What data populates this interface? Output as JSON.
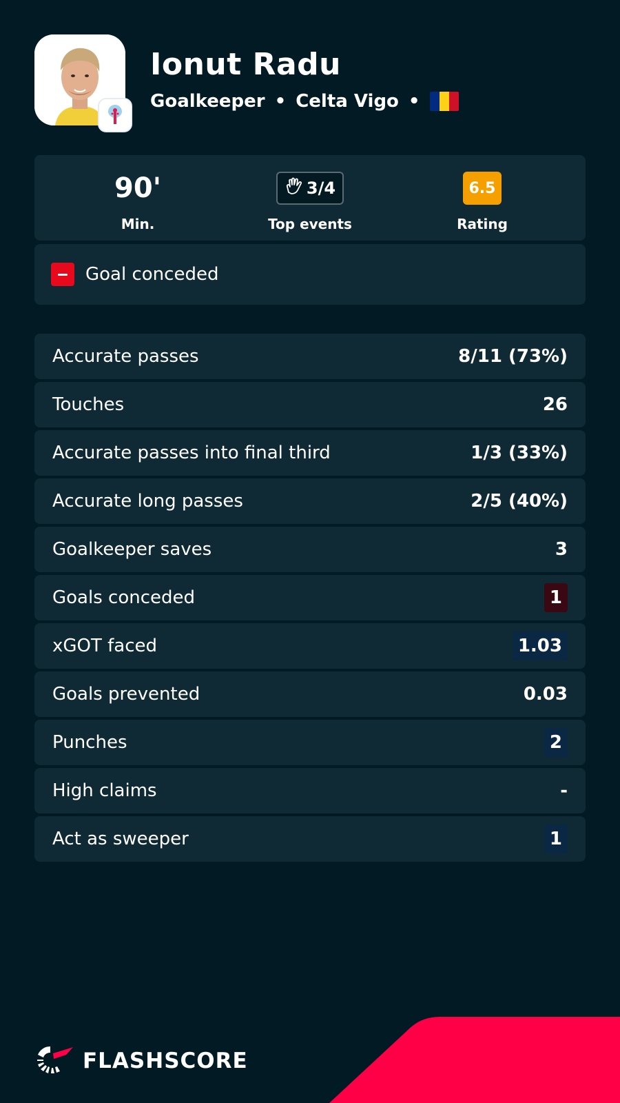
{
  "player": {
    "name": "Ionut Radu",
    "position": "Goalkeeper",
    "separator": "•",
    "club": "Celta Vigo",
    "flag_colors": [
      "#002B7F",
      "#FCD116",
      "#CE1126"
    ]
  },
  "summary": {
    "minutes": "90'",
    "minutes_label": "Min.",
    "top_events": "3/4",
    "top_events_icon": "goalkeeper-glove-icon",
    "top_events_label": "Top events",
    "rating": "6.5",
    "rating_label": "Rating",
    "rating_color": "#f6a000"
  },
  "event": {
    "icon": "goal-conceded-minus-icon",
    "label": "Goal conceded"
  },
  "stats": [
    {
      "label": "Accurate passes",
      "value": "8/11 (73%)"
    },
    {
      "label": "Touches",
      "value": "26"
    },
    {
      "label": "Accurate passes into final third",
      "value": "1/3 (33%)"
    },
    {
      "label": "Accurate long passes",
      "value": "2/5 (40%)"
    },
    {
      "label": "Goalkeeper saves",
      "value": "3"
    },
    {
      "label": "Goals conceded",
      "value": "1",
      "highlight": "red"
    },
    {
      "label": "xGOT faced",
      "value": "1.03",
      "highlight": "blue"
    },
    {
      "label": "Goals prevented",
      "value": "0.03"
    },
    {
      "label": "Punches",
      "value": "2",
      "highlight": "blue"
    },
    {
      "label": "High claims",
      "value": "-"
    },
    {
      "label": "Act as sweeper",
      "value": "1",
      "highlight": "blue"
    }
  ],
  "brand": {
    "name": "FLASHSCORE",
    "accent_color": "#ff0046"
  }
}
